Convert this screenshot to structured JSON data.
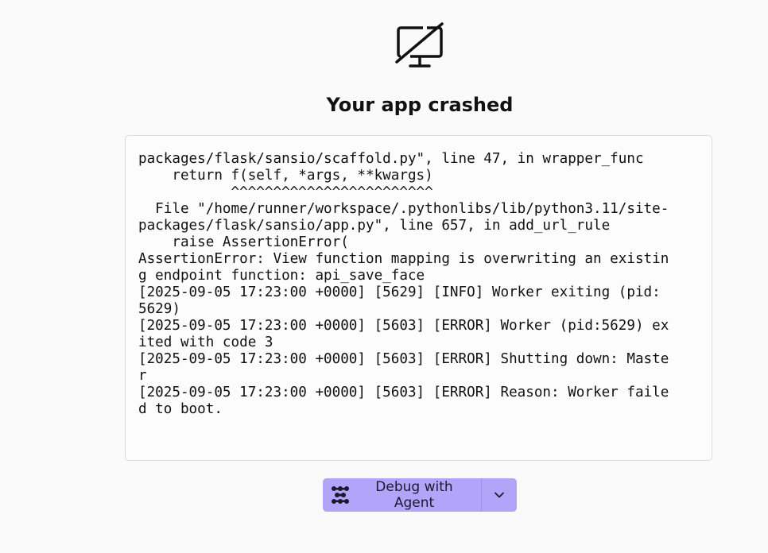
{
  "page": {
    "title": "Your app crashed"
  },
  "log": {
    "lines": [
      "packages/flask/sansio/scaffold.py\", line 47, in wrapper_func",
      "    return f(self, *args, **kwargs)",
      "           ^^^^^^^^^^^^^^^^^^^^^^^^",
      "  File \"/home/runner/workspace/.pythonlibs/lib/python3.11/site-",
      "packages/flask/sansio/app.py\", line 657, in add_url_rule",
      "    raise AssertionError(",
      "AssertionError: View function mapping is overwriting an existin",
      "g endpoint function: api_save_face",
      "[2025-09-05 17:23:00 +0000] [5629] [INFO] Worker exiting (pid:",
      "5629)",
      "[2025-09-05 17:23:00 +0000] [5603] [ERROR] Worker (pid:5629) ex",
      "ited with code 3",
      "[2025-09-05 17:23:00 +0000] [5603] [ERROR] Shutting down: Maste",
      "r",
      "[2025-09-05 17:23:00 +0000] [5603] [ERROR] Reason: Worker faile",
      "d to boot."
    ]
  },
  "actions": {
    "debug_label": "Debug with Agent",
    "debug_icon": "agent-icon",
    "dropdown_icon": "chevron-down-icon"
  },
  "icons": {
    "crash": "monitor-off-icon"
  },
  "colors": {
    "background": "#fafafa",
    "button": "#b2a4f9",
    "log_border": "#dcdcdc"
  }
}
